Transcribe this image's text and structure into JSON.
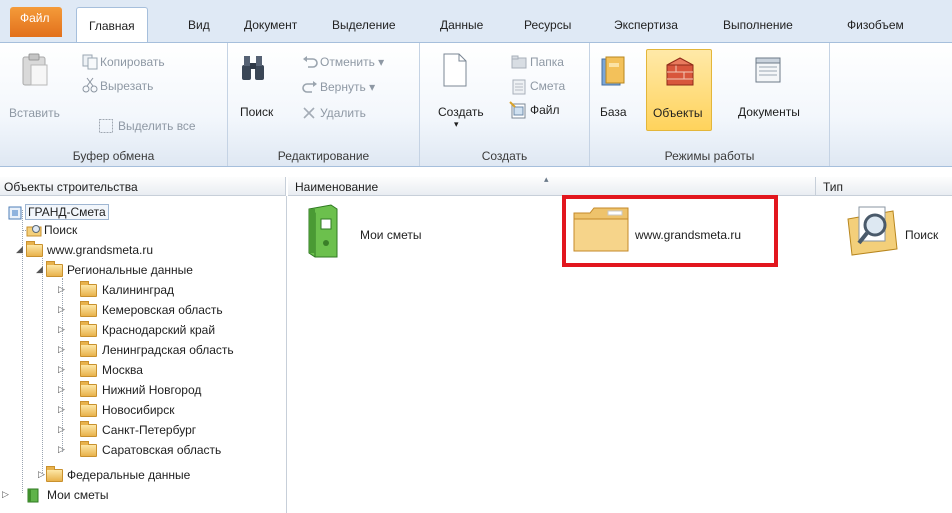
{
  "ribbon_tabs": {
    "file": "Файл",
    "tabs": [
      "Главная",
      "Вид",
      "Документ",
      "Выделение",
      "Данные",
      "Ресурсы",
      "Экспертиза",
      "Выполнение",
      "Физобъем"
    ]
  },
  "ribbon": {
    "clipboard": {
      "paste": "Вставить",
      "copy": "Копировать",
      "cut": "Вырезать",
      "select_all": "Выделить все",
      "label": "Буфер обмена"
    },
    "editing": {
      "search": "Поиск",
      "undo": "Отменить",
      "redo": "Вернуть",
      "delete": "Удалить",
      "label": "Редактирование"
    },
    "create": {
      "create": "Создать",
      "folder": "Папка",
      "estimate": "Смета",
      "file": "Файл",
      "label": "Создать"
    },
    "modes": {
      "base": "База",
      "objects": "Объекты",
      "documents": "Документы",
      "label": "Режимы работы"
    }
  },
  "tree": {
    "header": "Объекты строительства",
    "root": "ГРАНД-Смета",
    "search": "Поиск",
    "site": "www.grandsmeta.ru",
    "regional": "Региональные данные",
    "regions": [
      "Калининград",
      "Кемеровская область",
      "Краснодарский край",
      "Ленинградская область",
      "Москва",
      "Нижний Новгород",
      "Новосибирск",
      "Санкт-Петербург",
      "Саратовская область"
    ],
    "federal": "Федеральные данные",
    "my_estimates": "Мои сметы"
  },
  "list": {
    "col_name": "Наименование",
    "col_type": "Тип",
    "items": [
      "Мои сметы",
      "www.grandsmeta.ru",
      "Поиск"
    ]
  },
  "colors": {
    "highlight": "#e2161e",
    "file_tab": "#e2701c",
    "active_mode": "#ffd35c"
  }
}
